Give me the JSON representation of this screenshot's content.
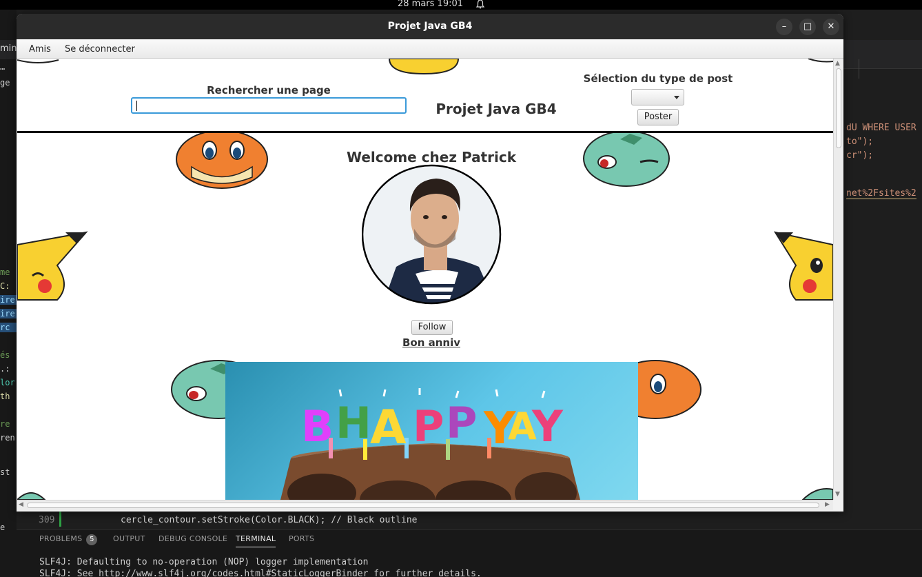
{
  "system": {
    "clock": "28 mars  19:01",
    "bell_icon": "bell-icon"
  },
  "vscode": {
    "left_tab_text": "mina",
    "left_texts": [
      "…",
      "ge",
      "me",
      "C:",
      "ire",
      "ire",
      "rc",
      "és",
      ".:",
      "lor",
      "th",
      "re",
      "ren",
      "st",
      "e"
    ],
    "right_code": [
      {
        "text": "dU WHERE USER",
        "color": "#ce9178"
      },
      {
        "text": "to\");",
        "color": "#ce9178"
      },
      {
        "text": "cr\");",
        "color": "#ce9178"
      },
      {
        "text": "net%2Fsites%2",
        "color": "#ce9178"
      }
    ],
    "line_number": "309",
    "code_line_309": "cercle_contour.setStroke(Color.BLACK); // Black outline",
    "panel_tabs": {
      "problems": "PROBLEMS",
      "problems_count": "5",
      "output": "OUTPUT",
      "debug_console": "DEBUG CONSOLE",
      "terminal": "TERMINAL",
      "ports": "PORTS"
    },
    "terminal_lines": [
      "SLF4J: Defaulting to no-operation (NOP) logger implementation",
      "SLF4J: See http://www.slf4j.org/codes.html#StaticLoggerBinder for further details."
    ]
  },
  "window": {
    "title": "Projet Java GB4",
    "menu": {
      "friends": "Amis",
      "logout": "Se déconnecter"
    },
    "header": {
      "search_label": "Rechercher une page",
      "search_value": "",
      "app_title": "Projet Java GB4",
      "post_type_label": "Sélection du type de post",
      "post_type_selected": "",
      "post_button": "Poster"
    },
    "profile": {
      "welcome": "Welcome chez Patrick",
      "follow_button": "Follow"
    },
    "post": {
      "title": "Bon anniv",
      "candle_letters": [
        "B",
        "H",
        "A",
        "P",
        "P",
        "Y",
        "A",
        "Y"
      ]
    }
  },
  "colors": {
    "accent": "#3a9ad9",
    "titlebar": "#2b2b2b",
    "terminal_bg": "#181818"
  }
}
